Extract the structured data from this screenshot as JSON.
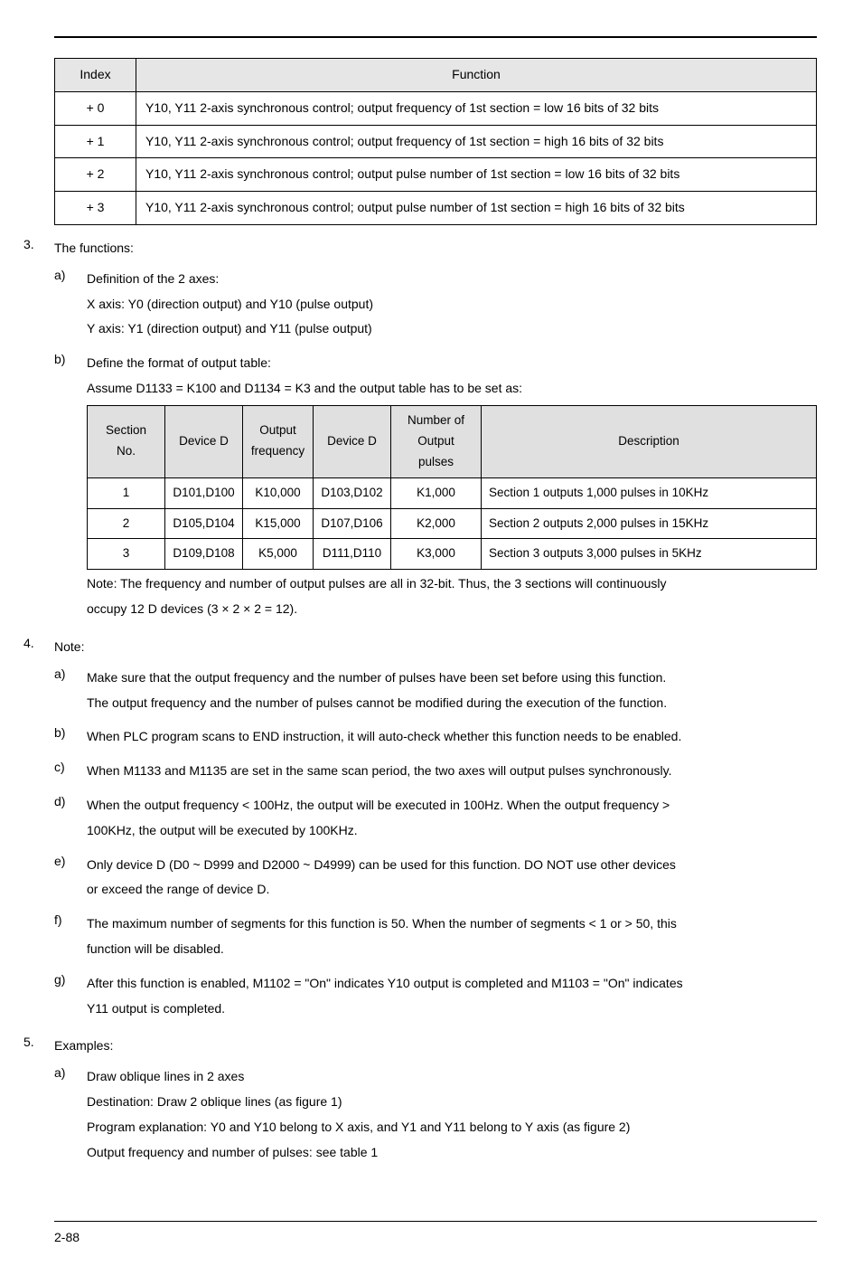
{
  "table1": {
    "head": [
      "Index",
      "Function"
    ],
    "rows": [
      {
        "idx": "+ 0",
        "fn": "Y10, Y11 2-axis synchronous control; output frequency of 1st section = low 16 bits of 32 bits"
      },
      {
        "idx": "+ 1",
        "fn": "Y10, Y11 2-axis synchronous control; output frequency of 1st section = high 16 bits of 32 bits"
      },
      {
        "idx": "+ 2",
        "fn": "Y10, Y11 2-axis synchronous control; output pulse number of 1st section = low 16 bits of 32 bits"
      },
      {
        "idx": "+ 3",
        "fn": "Y10, Y11 2-axis synchronous control; output pulse number of 1st section = high 16 bits of 32 bits"
      }
    ]
  },
  "item3": {
    "marker": "3.",
    "title": "The functions:",
    "a": {
      "marker": "a)",
      "title": "Definition of the 2 axes:",
      "line1": "X axis: Y0 (direction output) and Y10 (pulse output)",
      "line2": "Y axis: Y1 (direction output) and Y11 (pulse output)"
    },
    "b": {
      "marker": "b)",
      "title": "Define the format of output table:",
      "assume": "Assume D1133 = K100 and D1134 = K3 and the output table has to be set as:",
      "note1": "Note: The frequency and number of output pulses are all in 32-bit. Thus, the 3 sections will continuously",
      "note2": "occupy 12 D devices (3 × 2 × 2 = 12)."
    }
  },
  "sectable": {
    "head": [
      "Section No.",
      "Device D",
      "Output frequency",
      "Device D",
      "Number of Output pulses",
      "Description"
    ],
    "rows": [
      {
        "c0": "1",
        "c1": "D101,D100",
        "c2": "K10,000",
        "c3": "D103,D102",
        "c4": "K1,000",
        "c5": "Section 1 outputs 1,000 pulses in 10KHz"
      },
      {
        "c0": "2",
        "c1": "D105,D104",
        "c2": "K15,000",
        "c3": "D107,D106",
        "c4": "K2,000",
        "c5": "Section 2 outputs 2,000 pulses in 15KHz"
      },
      {
        "c0": "3",
        "c1": "D109,D108",
        "c2": "K5,000",
        "c3": "D111,D110",
        "c4": "K3,000",
        "c5": "Section 3 outputs 3,000 pulses in 5KHz"
      }
    ]
  },
  "item4": {
    "marker": "4.",
    "title": "Note:",
    "a": {
      "m": "a)",
      "l1": "Make sure that the output frequency and the number of pulses have been set before using this function.",
      "l2": "The output frequency and the number of pulses cannot be modified during the execution of the function."
    },
    "b": {
      "m": "b)",
      "t": "When PLC program scans to END instruction, it will auto-check whether this function needs to be enabled."
    },
    "c": {
      "m": "c)",
      "t": "When M1133 and M1135 are set in the same scan period, the two axes will output pulses synchronously."
    },
    "d": {
      "m": "d)",
      "l1": "When the output frequency < 100Hz, the output will be executed in 100Hz. When the output frequency >",
      "l2": "100KHz, the output will be executed by 100KHz."
    },
    "e": {
      "m": "e)",
      "l1": "Only device D (D0 ~ D999 and D2000 ~ D4999) can be used for this function. DO NOT use other devices",
      "l2": "or exceed the range of device D."
    },
    "f": {
      "m": "f)",
      "l1": "The maximum number of segments for this function is 50. When the number of segments < 1 or > 50, this",
      "l2": "function will be disabled."
    },
    "g": {
      "m": "g)",
      "l1": "After this function is enabled, M1102 = \"On\" indicates Y10 output is completed and M1103 = \"On\" indicates",
      "l2": "Y11 output is completed."
    }
  },
  "item5": {
    "marker": "5.",
    "title": "Examples:",
    "a": {
      "m": "a)",
      "t": "Draw oblique lines in 2 axes",
      "l1": "Destination: Draw 2 oblique lines (as figure 1)",
      "l2": "Program explanation: Y0 and Y10 belong to X axis, and Y1 and Y11 belong to Y axis (as figure 2)",
      "l3": "Output frequency and number of pulses: see table 1"
    }
  },
  "footer": "2-88",
  "chart_data": {
    "type": "table",
    "title": "Output table (example, D1133=K100, D1134=K3)",
    "columns": [
      "Section No.",
      "Device D (freq)",
      "Output frequency",
      "Device D (pulses)",
      "Number of Output pulses",
      "Description"
    ],
    "rows": [
      [
        1,
        "D101,D100",
        10000,
        "D103,D102",
        1000,
        "Section 1 outputs 1,000 pulses in 10KHz"
      ],
      [
        2,
        "D105,D104",
        15000,
        "D107,D106",
        2000,
        "Section 2 outputs 2,000 pulses in 15KHz"
      ],
      [
        3,
        "D109,D108",
        5000,
        "D111,D110",
        3000,
        "Section 3 outputs 3,000 pulses in 5KHz"
      ]
    ]
  }
}
